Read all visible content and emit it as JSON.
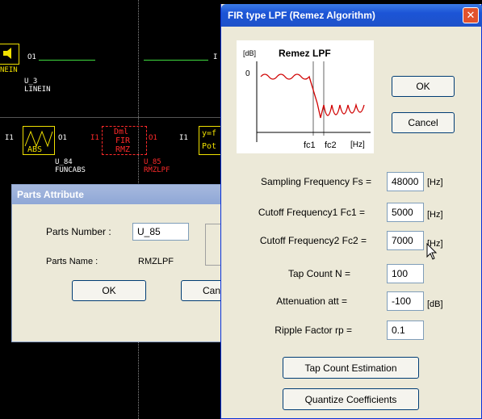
{
  "schematic": {
    "block_linein": {
      "inst": "U_3",
      "type": "LINEIN",
      "label": "NEIN",
      "out": "O1"
    },
    "block_funcabs": {
      "inst": "U_84",
      "type": "FUNCABS",
      "label": "ABS",
      "in": "I1",
      "out": "O1"
    },
    "block_rmzlpf": {
      "inst": "U_85",
      "type": "RMZLPF",
      "in": "I1",
      "out": "O1",
      "label_top": "Dml",
      "label_mid": "FIR",
      "label_bot": "RMZ"
    },
    "block_right": {
      "in": "I1",
      "label_top": "y=f",
      "label_bot": "Pot"
    },
    "pin_i_top": "I"
  },
  "parts_attribute": {
    "title": "Parts Attribute",
    "parts_number_label": "Parts Number :",
    "parts_number_value": "U_85",
    "parts_name_label": "Parts Name :",
    "parts_name_value": "RMZLPF",
    "ok_label": "OK",
    "cancel_label": "Can"
  },
  "fir_dialog": {
    "title": "FIR type LPF (Remez Algorithm)",
    "close_glyph": "✕",
    "graph": {
      "title": "Remez LPF",
      "y_unit": "[dB]",
      "y_zero": "0",
      "fc1": "fc1",
      "fc2": "fc2",
      "x_unit": "[Hz]"
    },
    "ok_label": "OK",
    "cancel_label": "Cancel",
    "fields": [
      {
        "label": "Sampling Frequency Fs =",
        "value": "48000",
        "unit": "[Hz]"
      },
      {
        "label": "Cutoff Frequency1 Fc1 =",
        "value": "5000",
        "unit": "[Hz]"
      },
      {
        "label": "Cutoff Frequency2 Fc2 =",
        "value": "7000",
        "unit": "[Hz]"
      },
      {
        "label": "Tap Count N =",
        "value": "100",
        "unit": ""
      },
      {
        "label": "Attenuation att =",
        "value": "-100",
        "unit": "[dB]"
      },
      {
        "label": "Ripple Factor rp =",
        "value": "0.1",
        "unit": ""
      }
    ],
    "tap_count_estimation_label": "Tap Count Estimation",
    "quantize_label": "Quantize Coefficients"
  }
}
